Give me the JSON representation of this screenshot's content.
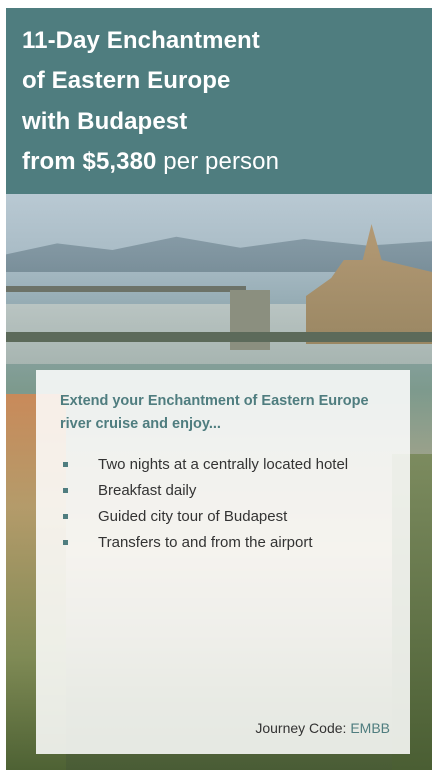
{
  "header": {
    "title_line1": "11-Day Enchantment",
    "title_line2": "of Eastern Europe",
    "title_line3": "with Budapest",
    "price": "from $5,380",
    "price_suffix": "per person"
  },
  "panel": {
    "headline": "Extend your Enchantment of Eastern Europe river cruise and enjoy...",
    "bullets": [
      "Two nights at a centrally located hotel",
      "Breakfast daily",
      "Guided city tour of Budapest",
      "Transfers to and from the airport"
    ],
    "journey_label": "Journey Code:",
    "journey_code": "EMBB"
  },
  "colors": {
    "accent": "#4f7d7f"
  }
}
